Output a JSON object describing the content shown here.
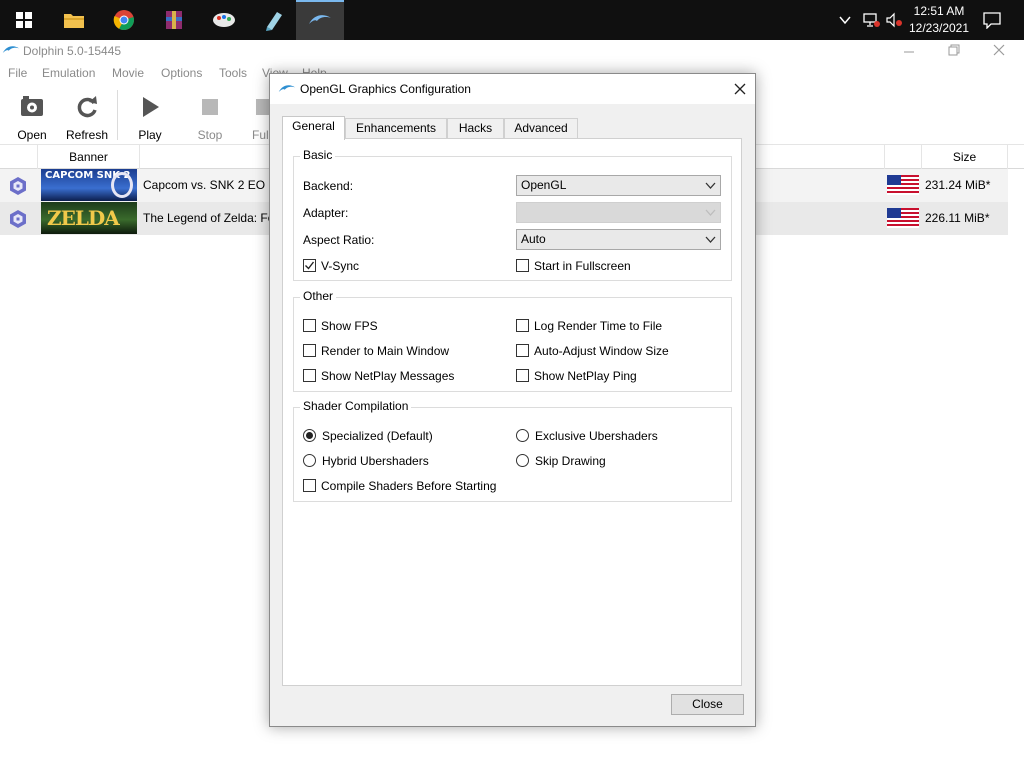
{
  "taskbar": {
    "apps": [
      {
        "icon": "windows-start-icon"
      },
      {
        "icon": "file-explorer-icon"
      },
      {
        "icon": "chrome-icon"
      },
      {
        "icon": "winrar-icon"
      },
      {
        "icon": "paint-app-icon"
      },
      {
        "icon": "notes-app-icon"
      },
      {
        "icon": "dolphin-icon",
        "active": true
      }
    ],
    "time": "12:51 AM",
    "date": "12/23/2021"
  },
  "main_window": {
    "title": "Dolphin 5.0-15445",
    "menu": [
      "File",
      "Emulation",
      "Movie",
      "Options",
      "Tools",
      "View",
      "Help"
    ],
    "toolbar": {
      "open": "Open",
      "refresh": "Refresh",
      "play": "Play",
      "stop": "Stop",
      "fullscreen": "Full"
    },
    "columns": {
      "banner": "Banner",
      "size": "Size"
    },
    "games": [
      {
        "name": "Capcom vs. SNK 2 EO",
        "size": "231.24 MiB*",
        "banner_text": "CAPCOM SNK 2"
      },
      {
        "name": "The Legend of Zelda: Fo",
        "size": "226.11 MiB*",
        "banner_text": "ZELDA"
      }
    ]
  },
  "dialog": {
    "title": "OpenGL Graphics Configuration",
    "tabs": [
      "General",
      "Enhancements",
      "Hacks",
      "Advanced"
    ],
    "active_tab": "General",
    "basic": {
      "title": "Basic",
      "backend_label": "Backend:",
      "backend_value": "OpenGL",
      "adapter_label": "Adapter:",
      "adapter_value": "",
      "aspect_label": "Aspect Ratio:",
      "aspect_value": "Auto",
      "vsync": {
        "label": "V-Sync",
        "checked": true
      },
      "fullscreen": {
        "label": "Start in Fullscreen",
        "checked": false
      }
    },
    "other": {
      "title": "Other",
      "show_fps": "Show FPS",
      "log_render_time": "Log Render Time to File",
      "render_main": "Render to Main Window",
      "auto_adjust": "Auto-Adjust Window Size",
      "netplay_messages": "Show NetPlay Messages",
      "netplay_ping": "Show NetPlay Ping"
    },
    "shader": {
      "title": "Shader Compilation",
      "specialized": "Specialized (Default)",
      "exclusive": "Exclusive Ubershaders",
      "hybrid": "Hybrid Ubershaders",
      "skip": "Skip Drawing",
      "compile_before": "Compile Shaders Before Starting",
      "selected": "Specialized (Default)"
    },
    "close": "Close"
  },
  "colors": {
    "taskbar_bg": "#101010",
    "dolphin_accent": "#2e8fd1",
    "active_tab_indicator": "#7ab8ee"
  }
}
